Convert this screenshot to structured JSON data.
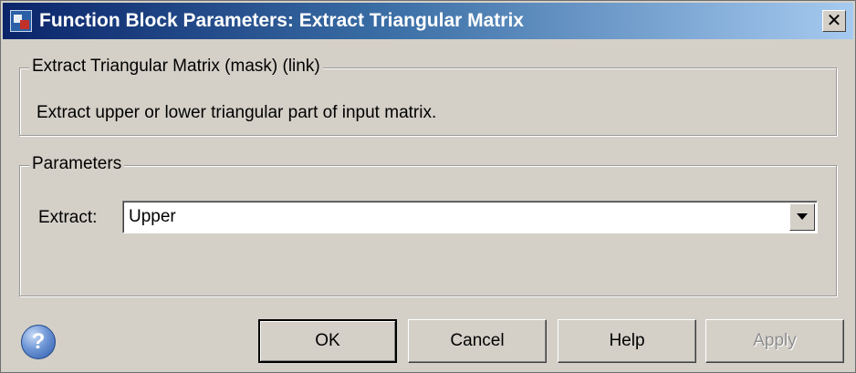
{
  "window": {
    "title": "Function Block Parameters: Extract Triangular Matrix",
    "close_glyph": "✕"
  },
  "description_group": {
    "legend": "Extract Triangular Matrix (mask) (link)",
    "text": "Extract upper or lower triangular part of input matrix."
  },
  "parameters_group": {
    "legend": "Parameters",
    "extract_label": "Extract:",
    "extract_value": "Upper"
  },
  "buttons": {
    "ok": "OK",
    "cancel": "Cancel",
    "help": "Help",
    "apply": "Apply"
  },
  "help_icon_glyph": "?",
  "icons": {
    "window_icon": "simulink-block-icon",
    "close": "close-icon",
    "dropdown": "chevron-down-icon",
    "help": "help-icon"
  }
}
